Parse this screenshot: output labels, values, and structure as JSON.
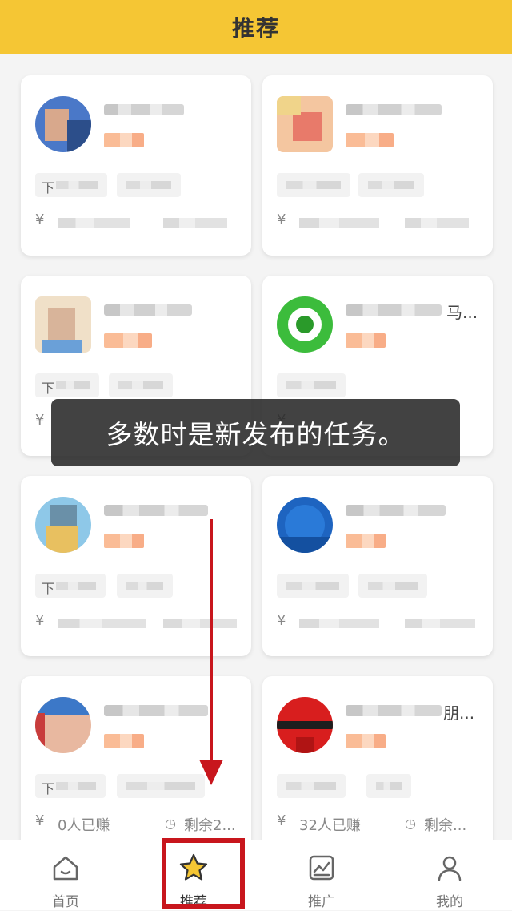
{
  "header": {
    "title": "推荐"
  },
  "cards": [
    {
      "prefix": "下",
      "currency": "¥",
      "stat_left": "",
      "stat_right": "",
      "avatar": [
        "#4a78c8",
        "#d8a88c",
        "#2c4e8a"
      ]
    },
    {
      "prefix": "",
      "currency": "¥",
      "stat_left": "",
      "stat_right": "",
      "avatar": [
        "#f4c6a0",
        "#e87a6a",
        "#f0d48a"
      ]
    },
    {
      "prefix": "下",
      "currency": "¥",
      "stat_left": "",
      "stat_right": "",
      "avatar": [
        "#d8b49a",
        "#6aa0d8",
        "#f0e0c8"
      ]
    },
    {
      "prefix": "",
      "currency": "¥",
      "stat_left": "",
      "stat_right": "",
      "avatar": [
        "#3cbc3c",
        "#ffffff",
        "#2a9a2a"
      ]
    },
    {
      "prefix": "下",
      "currency": "¥",
      "stat_left": "",
      "stat_right": "",
      "avatar": [
        "#8ec8e8",
        "#e8c060",
        "#6a90a8"
      ]
    },
    {
      "prefix": "",
      "currency": "¥",
      "stat_left": "",
      "stat_right": "",
      "avatar": [
        "#1e64c0",
        "#2a7ad8",
        "#1450a0"
      ]
    },
    {
      "prefix": "下",
      "currency": "¥",
      "stat_left": "0人已赚",
      "stat_right": "剩余2...",
      "avatar": [
        "#e8b8a0",
        "#3c78c8",
        "#c83c3c"
      ]
    },
    {
      "prefix": "",
      "currency": "¥",
      "stat_left": "32人已赚",
      "stat_right": "剩余...",
      "avatar": [
        "#d81e1e",
        "#1e1e1e",
        "#b01414"
      ]
    }
  ],
  "card_name_suffix": {
    "card_4": "马...",
    "card_8": "朋..."
  },
  "tip": {
    "text": "多数时是新发布的任务。"
  },
  "tabbar": {
    "tabs": [
      {
        "label": "首页",
        "icon": "home-icon"
      },
      {
        "label": "推荐",
        "icon": "star-icon"
      },
      {
        "label": "推广",
        "icon": "chart-icon"
      },
      {
        "label": "我的",
        "icon": "user-icon"
      }
    ],
    "active": 1
  },
  "colors": {
    "header_bg": "#f5c634",
    "accent_red": "#c8161d",
    "star_yellow": "#f5c634"
  }
}
